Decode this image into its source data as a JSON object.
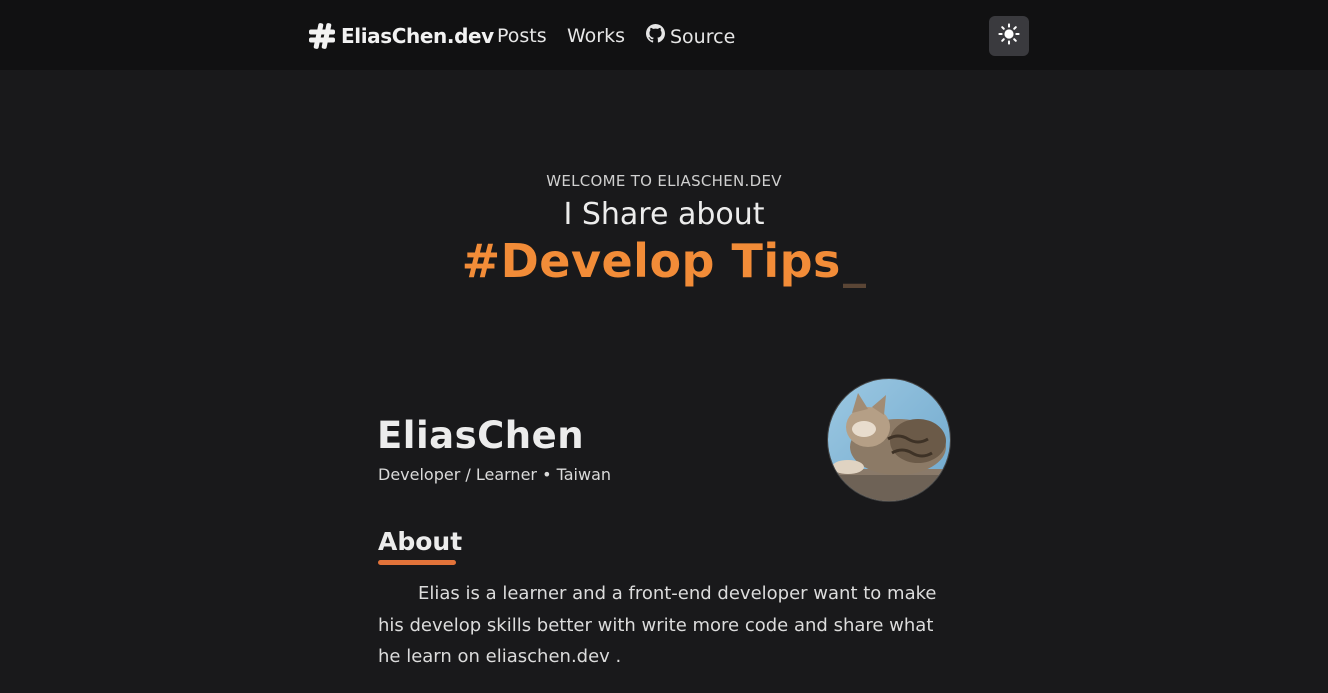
{
  "navbar": {
    "logo_text": "EliasChen.dev",
    "links": [
      "Posts",
      "Works",
      "Source"
    ],
    "icons": {
      "logo": "hashtag-icon",
      "source": "github-icon",
      "theme_toggle": "sun-icon"
    }
  },
  "hero": {
    "welcome": "WELCOME TO ELIASCHEN.DEV",
    "line": "I Share about",
    "topic": "#Develop Tips",
    "cursor": "_"
  },
  "profile": {
    "name": "EliasChen",
    "subtitle": "Developer / Learner • Taiwan"
  },
  "about": {
    "heading": "About",
    "body": "Elias is a learner and a front-end developer want to make his develop skills better with write more code and share what he learn on eliaschen.dev ."
  },
  "colors": {
    "accent": "#f28c38",
    "underline": "#e2733a",
    "background": "#19191b",
    "navbar": "#111112"
  }
}
